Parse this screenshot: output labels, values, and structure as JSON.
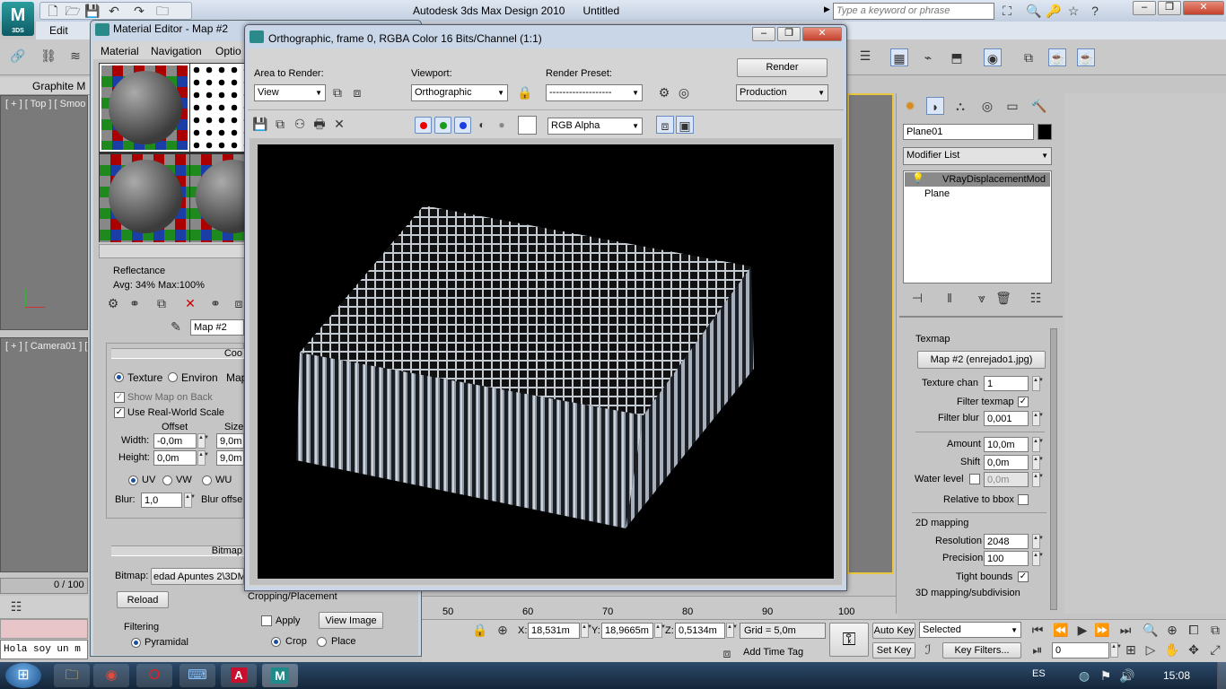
{
  "app": {
    "title": "Autodesk 3ds Max Design 2010",
    "file": "Untitled",
    "logo_text": "3DS",
    "menu_edit": "Edit",
    "search_placeholder": "Type a keyword or phrase",
    "graphite_tab": "Graphite M",
    "vp_top_label": "[ + ] [ Top ] [ Smoo",
    "vp_cam_label": "[ + ] [ Camera01 ] [",
    "time_slider": "0 / 100",
    "maxscript_text": "Hola soy un m",
    "ruler_ticks": [
      "50",
      "60",
      "70",
      "80",
      "90",
      "100"
    ]
  },
  "material_editor": {
    "title": "Material Editor - Map #2",
    "menus": [
      "Material",
      "Navigation",
      "Optio"
    ],
    "reflectance_label": "Reflectance",
    "reflectance_value": "Avg:  34% Max:100%",
    "map_name": "Map #2",
    "coords_header": "Coo",
    "radio_texture": "Texture",
    "radio_environ": "Environ",
    "map_label": "Map",
    "show_map_on_back": "Show Map on Back",
    "real_world_scale": "Use Real-World Scale",
    "offset_label": "Offset",
    "size_label": "Size",
    "width_label": "Width:",
    "width_offset": "-0,0m",
    "width_size": "9,0m",
    "height_label": "Height:",
    "height_offset": "0,0m",
    "height_size": "9,0m",
    "uv": "UV",
    "vw": "VW",
    "wu": "WU",
    "blur_label": "Blur:",
    "blur_value": "1,0",
    "blur_offset_label": "Blur offse",
    "bitmap_header": "Bitmap",
    "bitmap_label": "Bitmap:",
    "bitmap_path": "edad Apuntes 2\\3DMa",
    "reload": "Reload",
    "filtering": "Filtering",
    "pyramidal": "Pyramidal",
    "cropping": "Cropping/Placement",
    "apply": "Apply",
    "view_image": "View Image",
    "crop": "Crop",
    "place": "Place"
  },
  "render_window": {
    "title": "Orthographic, frame 0, RGBA Color 16 Bits/Channel (1:1)",
    "area_label": "Area to Render:",
    "area_value": "View",
    "viewport_label": "Viewport:",
    "viewport_value": "Orthographic",
    "preset_label": "Render Preset:",
    "preset_value": "-------------------",
    "render_button": "Render",
    "production_value": "Production",
    "channel_value": "RGB Alpha"
  },
  "command_panel": {
    "object_name": "Plane01",
    "modifier_list": "Modifier List",
    "stack": [
      "VRayDisplacementMod",
      "Plane"
    ],
    "texmap_title": "Texmap",
    "texmap_button": "Map #2 (enrejado1.jpg)",
    "texture_chan_label": "Texture chan",
    "texture_chan_value": "1",
    "filter_texmap_label": "Filter texmap",
    "filter_blur_label": "Filter blur",
    "filter_blur_value": "0,001",
    "amount_label": "Amount",
    "amount_value": "10,0m",
    "shift_label": "Shift",
    "shift_value": "0,0m",
    "water_level_label": "Water level",
    "water_level_value": "0,0m",
    "relative_bbox_label": "Relative to bbox",
    "mapping_2d": "2D mapping",
    "resolution_label": "Resolution",
    "resolution_value": "2048",
    "precision_label": "Precision",
    "precision_value": "100",
    "tight_bounds_label": "Tight bounds",
    "mapping_3d": "3D mapping/subdivision"
  },
  "status": {
    "x_label": "X:",
    "x_value": "18,531m",
    "y_label": "Y:",
    "y_value": "18,9665m",
    "z_label": "Z:",
    "z_value": "0,5134m",
    "grid": "Grid = 5,0m",
    "add_time_tag": "Add Time Tag",
    "auto_key": "Auto Key",
    "selected": "Selected",
    "set_key": "Set Key",
    "key_filters": "Key Filters...",
    "frame_value": "0"
  },
  "taskbar": {
    "lang": "ES",
    "clock": "15:08"
  }
}
